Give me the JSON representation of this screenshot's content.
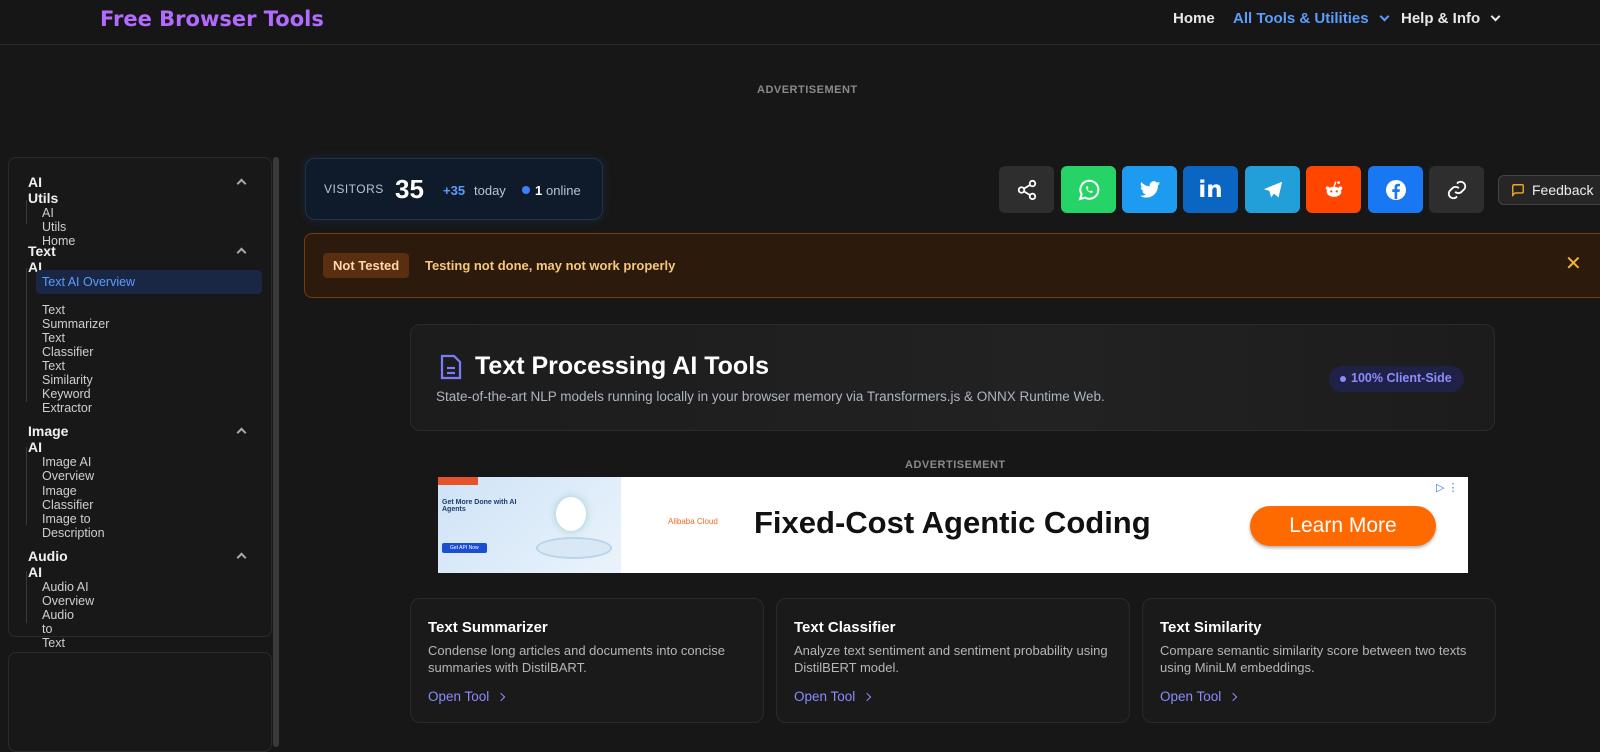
{
  "header": {
    "logo": "Free Browser Tools",
    "nav": [
      {
        "label": "Home"
      },
      {
        "label": "All Tools & Utilities"
      },
      {
        "label": "Help & Info"
      }
    ]
  },
  "ads": {
    "top_label": "ADVERTISEMENT",
    "mid_label": "ADVERTISEMENT",
    "banner": {
      "image_title": "Get More Done with AI Agents",
      "image_button": "Get API Now",
      "brand": "Alibaba Cloud",
      "headline": "Fixed-Cost Agentic Coding",
      "cta": "Learn More"
    }
  },
  "sidebar": {
    "sections": [
      {
        "title": "AI Utils",
        "items": [
          "AI Utils Home"
        ]
      },
      {
        "title": "Text AI",
        "items": [
          "Text AI Overview",
          "Text Summarizer",
          "Text Classifier",
          "Text Similarity",
          "Keyword Extractor"
        ]
      },
      {
        "title": "Image AI",
        "items": [
          "Image AI Overview",
          "Image Classifier",
          "Image to Description"
        ]
      },
      {
        "title": "Audio AI",
        "items": [
          "Audio AI Overview",
          "Audio to Text"
        ]
      }
    ],
    "active_item": "Text AI Overview"
  },
  "visitors": {
    "label": "VISITORS",
    "count": "35",
    "today_delta": "+35",
    "today_label": "today",
    "online_count": "1",
    "online_label": "online"
  },
  "share": {
    "buttons": [
      {
        "name": "share",
        "color": "#2e2e2e"
      },
      {
        "name": "whatsapp",
        "color": "#25d366"
      },
      {
        "name": "twitter",
        "color": "#1d9bf0"
      },
      {
        "name": "linkedin",
        "color": "#0a66c2"
      },
      {
        "name": "telegram",
        "color": "#229ed9"
      },
      {
        "name": "reddit",
        "color": "#ff4500"
      },
      {
        "name": "facebook",
        "color": "#1877f2"
      },
      {
        "name": "copy-link",
        "color": "#2e2e2e"
      }
    ],
    "feedback_label": "Feedback"
  },
  "notice": {
    "badge": "Not Tested",
    "text": "Testing not done, may not work properly",
    "close": "✕"
  },
  "hero": {
    "title": "Text Processing AI Tools",
    "subtitle": "State-of-the-art NLP models running locally in your browser memory via Transformers.js & ONNX Runtime Web.",
    "badge": "100% Client-Side"
  },
  "cards": [
    {
      "title": "Text Summarizer",
      "desc": "Condense long articles and documents into concise summaries with DistilBART.",
      "link": "Open Tool"
    },
    {
      "title": "Text Classifier",
      "desc": "Analyze text sentiment and sentiment probability using DistilBERT model.",
      "link": "Open Tool"
    },
    {
      "title": "Text Similarity",
      "desc": "Compare semantic similarity score between two texts using MiniLM embeddings.",
      "link": "Open Tool"
    }
  ]
}
